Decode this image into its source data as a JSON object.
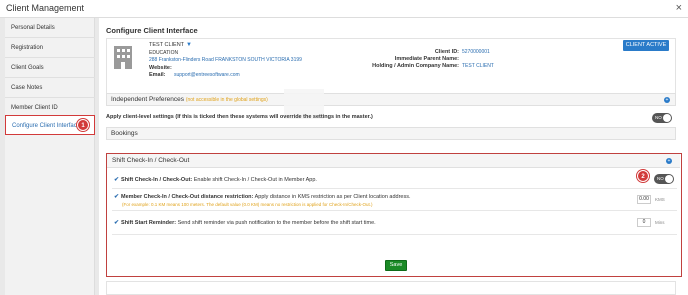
{
  "window": {
    "title": "Client Management",
    "close": "×"
  },
  "sidebar": {
    "items": [
      {
        "label": "Personal Details"
      },
      {
        "label": "Registration"
      },
      {
        "label": "Client Goals"
      },
      {
        "label": "Case Notes"
      },
      {
        "label": "Member Client ID"
      },
      {
        "label": "Configure Client Interface",
        "active": true
      }
    ],
    "badge": "1"
  },
  "main": {
    "page_title": "Configure Client Interface",
    "client": {
      "name": "TEST CLIENT",
      "type": "EDUCATION",
      "address": "288 Frankston-Flinders Road FRANKSTON SOUTH VICTORIA 3199",
      "website_label": "Website:",
      "email_label": "Email:",
      "email": "support@entreesoftware.com",
      "client_id_label": "Client ID:",
      "client_id": "5270000001",
      "parent_label": "Immediate Parent Name:",
      "holding_label": "Holding / Admin Company Name:",
      "holding_value": "TEST CLIENT",
      "status_button": "CLIENT ACTIVE"
    },
    "independent": {
      "title": "Independent Preferences",
      "note": "(not accessible in the global settings)"
    },
    "apply_label": "Apply client-level settings (If this is ticked then these systems will override the settings in the master.)",
    "bookings_title": "Bookings",
    "shift": {
      "title": "Shift Check-In / Check-Out",
      "badge": "2",
      "opt1_bold": "Shift Check-In / Check-Out:",
      "opt1_text": " Enable shift Check-In / Check-Out in Member App.",
      "opt2_bold": "Member Check-In / Check-Out distance restriction:",
      "opt2_text": " Apply distance in KMS restriction as per Client location address.",
      "opt2_sub": "(For example: 0.1 KM means 100 meters. The default value (0.0 KM) means no restriction is applied for Check-In/Check-Out.)",
      "opt2_value": "0.00",
      "opt2_unit": "KMS",
      "opt3_bold": "Shift Start Reminder:",
      "opt3_text": " Send shift reminder via push notification to the member before the shift start time.",
      "opt3_value": "0",
      "opt3_unit": "Mins",
      "save": "Save"
    },
    "toggle_label": "NO",
    "check": "✔",
    "plus": "+"
  },
  "colors": {
    "accent": "#2a7bc9",
    "highlight": "#d23a3a",
    "save": "#1b8a26"
  }
}
